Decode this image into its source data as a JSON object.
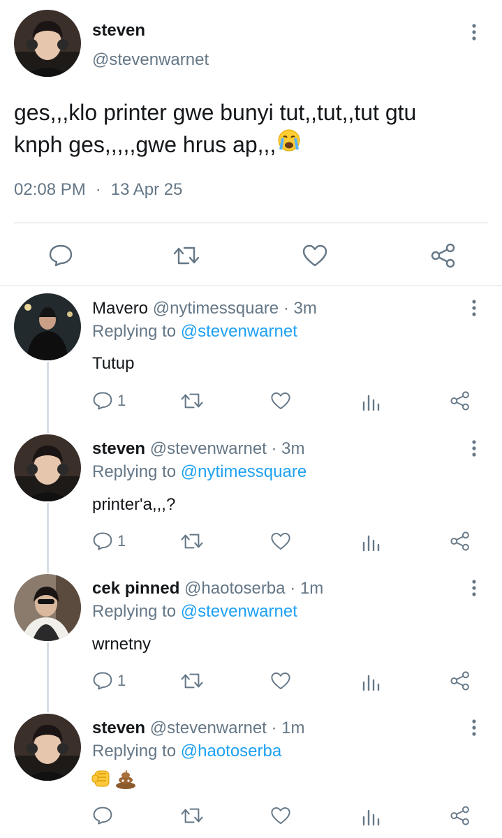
{
  "main_tweet": {
    "display_name": "steven",
    "handle": "@stevenwarnet",
    "text_line1": "ges,,,klo printer gwe bunyi tut,,tut,,tut gtu",
    "text_line2": "knph ges,,,,,gwe hrus ap,,,",
    "emoji": "loudly-crying-face",
    "time": "02:08 PM",
    "separator": "·",
    "date": "13 Apr 25",
    "actions": [
      "reply-icon",
      "retweet-icon",
      "like-icon",
      "share-icon"
    ]
  },
  "replies": [
    {
      "display_name": "Mavero",
      "handle": "@nytimessquare",
      "time": "· 3m",
      "replying_prefix": "Replying to",
      "replying_to": "@stevenwarnet",
      "text": "Tutup",
      "reply_count": "1"
    },
    {
      "display_name": "steven",
      "handle": "@stevenwarnet",
      "time": "· 3m",
      "replying_prefix": "Replying to",
      "replying_to": "@nytimessquare",
      "text": "printer'a,,,?",
      "reply_count": "1"
    },
    {
      "display_name": "cek pinned",
      "handle": "@haotoserba",
      "time": "· 1m",
      "replying_prefix": "Replying to",
      "replying_to": "@stevenwarnet",
      "text": "wrnetny",
      "reply_count": "1"
    },
    {
      "display_name": "steven",
      "handle": "@stevenwarnet",
      "time": "· 1m",
      "replying_prefix": "Replying to",
      "replying_to": "@haotoserba",
      "text": "",
      "emojis": [
        "fist-bump",
        "pile-of-poo"
      ],
      "reply_count": ""
    }
  ],
  "colors": {
    "link": "#1da1f2",
    "muted": "#657786",
    "text": "#14171a"
  }
}
